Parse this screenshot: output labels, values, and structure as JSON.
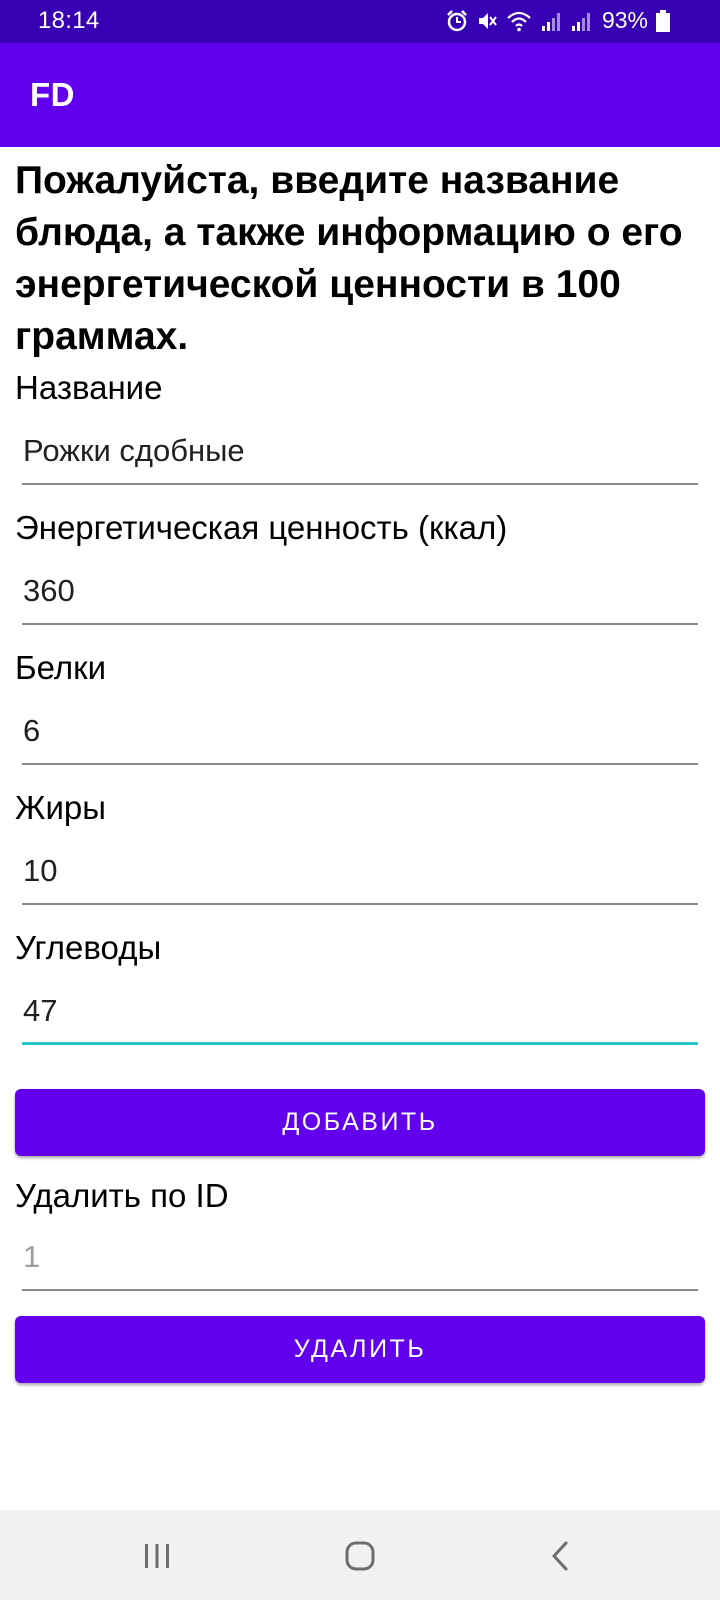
{
  "status_bar": {
    "time": "18:14",
    "battery": "93%",
    "icons": [
      "alarm-icon",
      "mute-icon",
      "wifi-icon",
      "signal-icon",
      "signal-icon",
      "battery-icon"
    ]
  },
  "app_bar": {
    "title": "FD"
  },
  "intro": {
    "text": "Пожалуйста, введите название блюда, а также информацию о его энергетической ценности в 100 граммах."
  },
  "form": {
    "name": {
      "label": "Название",
      "value": "Рожки сдобные"
    },
    "calories": {
      "label": "Энергетическая ценность (ккал)",
      "value": "360"
    },
    "proteins": {
      "label": "Белки",
      "value": "6"
    },
    "fats": {
      "label": "Жиры",
      "value": "10"
    },
    "carbs": {
      "label": "Углеводы",
      "value": "47"
    },
    "add_button": "ДОБАВИТЬ",
    "delete_label": "Удалить по ID",
    "delete_hint": "1",
    "delete_button": "УДАЛИТЬ"
  },
  "nav_bar": {
    "icons": [
      "recent-apps-icon",
      "home-icon",
      "back-icon"
    ]
  },
  "colors": {
    "status_bar": "#3700b3",
    "primary": "#6200ee",
    "focus_underline": "#26c6c6",
    "nav_bar": "#f1f1f1"
  }
}
